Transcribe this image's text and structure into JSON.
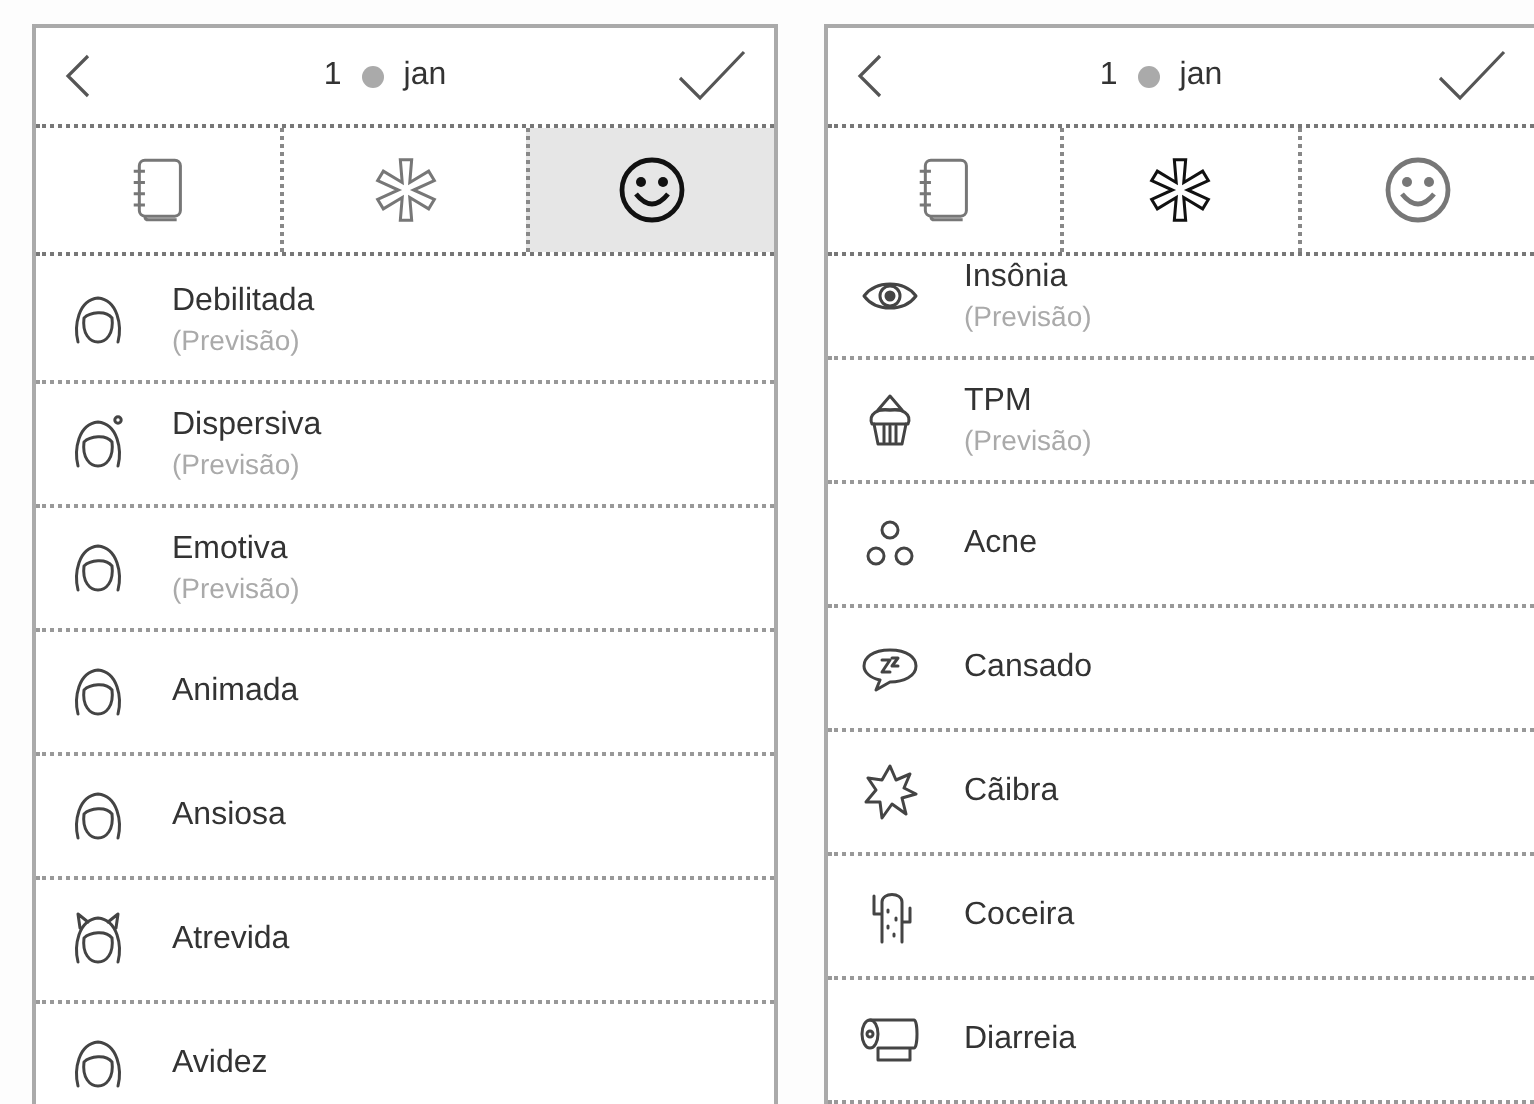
{
  "panels": [
    {
      "header": {
        "day": "1",
        "month": "jan"
      },
      "tabs": [
        {
          "selected": false,
          "shaded": false
        },
        {
          "selected": false,
          "shaded": false
        },
        {
          "selected": true,
          "shaded": true
        }
      ],
      "scrolled": false,
      "items": [
        {
          "label": "Debilitada",
          "note": "(Previsão)"
        },
        {
          "label": "Dispersiva",
          "note": "(Previsão)"
        },
        {
          "label": "Emotiva",
          "note": "(Previsão)"
        },
        {
          "label": "Animada"
        },
        {
          "label": "Ansiosa"
        },
        {
          "label": "Atrevida"
        },
        {
          "label": "Avidez"
        }
      ]
    },
    {
      "header": {
        "day": "1",
        "month": "jan"
      },
      "tabs": [
        {
          "selected": false,
          "shaded": false
        },
        {
          "selected": true,
          "shaded": false
        },
        {
          "selected": false,
          "shaded": false
        }
      ],
      "scrolled": true,
      "items": [
        {
          "label": "Insônia",
          "note": "(Previsão)"
        },
        {
          "label": "TPM",
          "note": "(Previsão)"
        },
        {
          "label": "Acne"
        },
        {
          "label": "Cansado"
        },
        {
          "label": "Cãibra"
        },
        {
          "label": "Coceira"
        },
        {
          "label": "Diarreia"
        }
      ]
    }
  ]
}
